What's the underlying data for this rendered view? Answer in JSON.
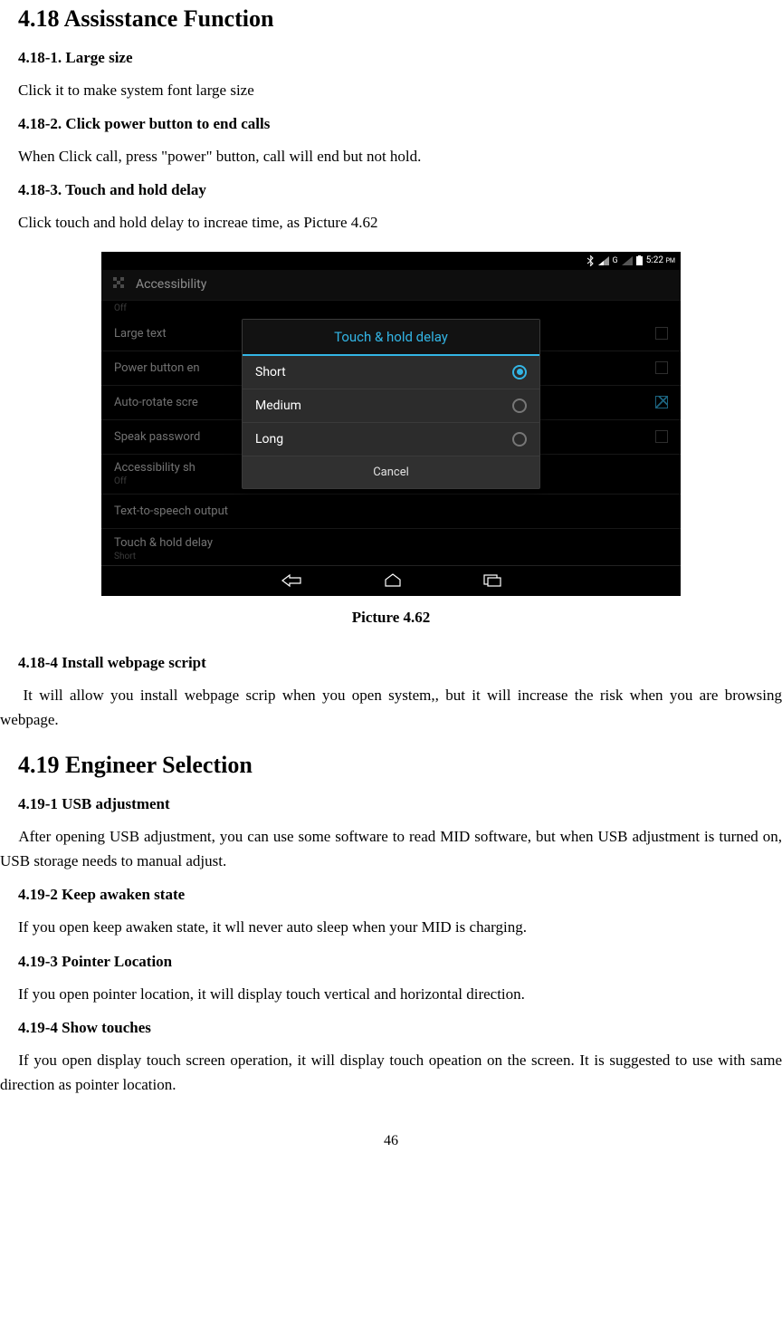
{
  "section_418": {
    "heading": "4.18 Assisstance Function",
    "s1": {
      "title": "4.18-1. Large size",
      "body": "Click it to make system font large size"
    },
    "s2": {
      "title": "4.18-2. Click power button to end calls",
      "body": "When Click call, press \"power\" button, call will end but not hold."
    },
    "s3": {
      "title": "4.18-3. Touch and hold delay",
      "body": "Click touch and hold delay to increae time, as Picture 4.62"
    },
    "s4": {
      "title": "4.18-4 Install webpage script",
      "body": "It will allow you install webpage scrip when you open system,, but it will increase the risk when you are browsing webpage."
    },
    "caption": "Picture 4.62"
  },
  "section_419": {
    "heading": "4.19 Engineer Selection",
    "s1": {
      "title": "4.19-1 USB adjustment",
      "body": "After opening USB adjustment, you can use some software to read MID software, but when USB adjustment is turned on, USB storage needs to manual adjust."
    },
    "s2": {
      "title": "4.19-2 Keep awaken state",
      "body": "If you open keep awaken state, it wll never auto sleep when your MID is charging."
    },
    "s3": {
      "title": "4.19-3 Pointer Location",
      "body": "If you open pointer location, it will display touch vertical and horizontal direction."
    },
    "s4": {
      "title": "4.19-4 Show touches",
      "body": "If you open display touch screen operation, it will display touch opeation on the screen. It is suggested to use with same direction as pointer location."
    }
  },
  "screenshot": {
    "status": {
      "time": "5:22",
      "ampm": "PM",
      "g": "G"
    },
    "header": "Accessibility",
    "rows": {
      "off_top": "Off",
      "large_text": "Large text",
      "power_button": "Power button en",
      "auto_rotate": "Auto-rotate scre",
      "speak_passwords": "Speak password",
      "accessibility_shortcut": "Accessibility sh",
      "accessibility_shortcut_sub": "Off",
      "tts": "Text-to-speech output",
      "touch_hold": "Touch & hold delay",
      "touch_hold_sub": "Short"
    },
    "dialog": {
      "title": "Touch & hold delay",
      "opt_short": "Short",
      "opt_medium": "Medium",
      "opt_long": "Long",
      "cancel": "Cancel"
    }
  },
  "page_number": "46"
}
